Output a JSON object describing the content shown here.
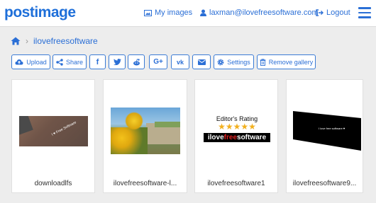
{
  "header": {
    "logo": "postimage",
    "my_images": "My images",
    "user_email": "laxman@ilovefreesoftware.com",
    "logout": "Logout"
  },
  "breadcrumb": {
    "gallery": "ilovefreesoftware"
  },
  "toolbar": {
    "upload": "Upload",
    "share": "Share",
    "settings": "Settings",
    "remove_gallery": "Remove gallery"
  },
  "gallery": {
    "items": [
      {
        "caption": "downloadlfs",
        "thumb_text": "I ♥ Free Software"
      },
      {
        "caption": "ilovefreesoftware-l..."
      },
      {
        "caption": "ilovefreesoftware1",
        "rating_title": "Editor's Rating",
        "stars": "★★★★★",
        "brand_a": "ilove",
        "brand_b": "free",
        "brand_c": "software"
      },
      {
        "caption": "ilovefreesoftware9...",
        "thumb_text": "I love free software ♥"
      }
    ]
  },
  "colors": {
    "accent": "#2b6fd6",
    "background": "#ededed",
    "star": "#f2b01e",
    "brand_red": "#e02020"
  }
}
